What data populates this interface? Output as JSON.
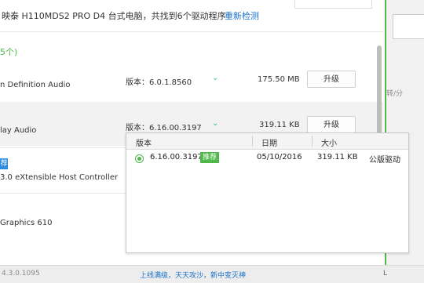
{
  "header": {
    "device_text": "映泰 H110MDS2 PRO D4 台式电脑，共找到6个驱动程序",
    "redetect_label": "重新检测"
  },
  "section_count": "5个)",
  "drivers": [
    {
      "name": "n Definition Audio",
      "version": "版本：6.0.1.8560",
      "size": "175.50 MB",
      "action": "升级"
    },
    {
      "name": "lay Audio",
      "version": "版本：6.16.00.3197",
      "size": "319.11 KB",
      "action": "升级"
    },
    {
      "tag": "荐",
      "name": "3.0 eXtensible Host Controller"
    },
    {
      "name": "Graphics 610"
    }
  ],
  "right_panel": {
    "label": "转/分"
  },
  "version_dropdown": {
    "columns": [
      "版本",
      "日期",
      "大小"
    ],
    "rows": [
      {
        "version": "6.16.00.3197",
        "badge": "推荐",
        "date": "05/10/2016",
        "size": "319.11 KB",
        "type": "公版驱动"
      }
    ]
  },
  "footer": {
    "version": "4.3.0.1095",
    "slogan": "上线满级，天天攻沙，新中变灭神",
    "right_icon": "L"
  },
  "icons": {
    "chevron": "chevron-down-icon"
  },
  "colors": {
    "accent": "#4fb848",
    "link": "#1a73c7"
  }
}
